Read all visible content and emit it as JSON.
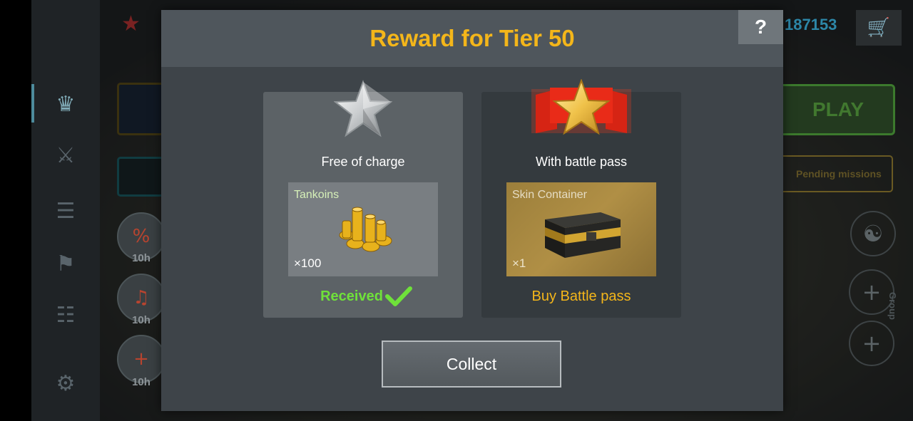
{
  "background": {
    "coins_value": "187153",
    "play_label": "PLAY",
    "pending_label": "Pending missions",
    "group_label": "Group",
    "timers": [
      "10h",
      "10h",
      "10h"
    ]
  },
  "modal": {
    "title": "Reward for Tier 50",
    "help_label": "?",
    "free_card": {
      "label": "Free of charge",
      "reward_name": "Tankoins",
      "reward_qty": "×100",
      "status": "Received",
      "icon": "silver-star-icon"
    },
    "pass_card": {
      "label": "With battle pass",
      "reward_name": "Skin Container",
      "reward_qty": "×1",
      "status": "Buy Battle pass",
      "icon": "gold-star-ribbon-icon"
    },
    "collect_label": "Collect"
  },
  "colors": {
    "title_gold": "#f4b61a",
    "received_green": "#6fe13a",
    "modal_bg": "#3e4449"
  }
}
